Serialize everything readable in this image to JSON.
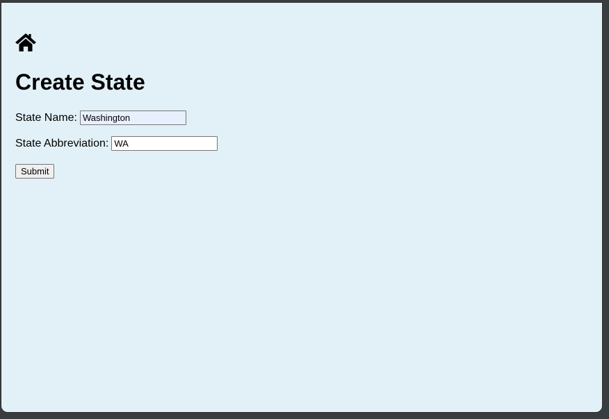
{
  "nav": {
    "home_icon": "home-icon"
  },
  "page": {
    "title": "Create State"
  },
  "form": {
    "state_name_label": "State Name:",
    "state_name_value": "Washington",
    "state_abbr_label": "State Abbreviation:",
    "state_abbr_value": "WA",
    "submit_label": "Submit"
  }
}
